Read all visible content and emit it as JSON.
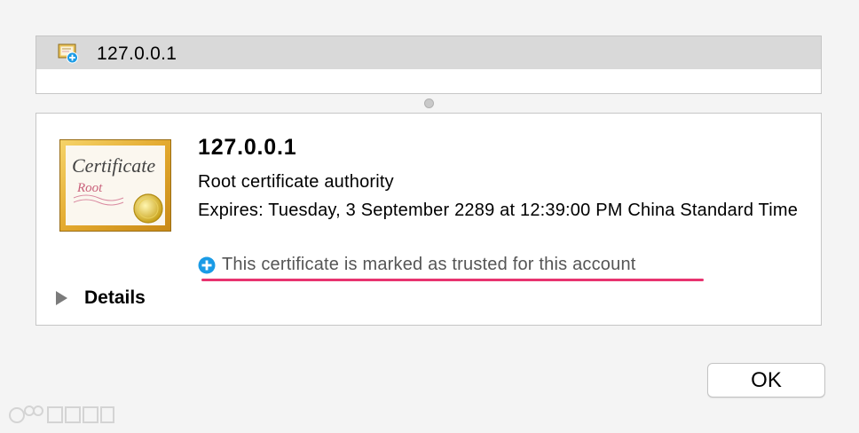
{
  "certificate_list": {
    "selected_item": "127.0.0.1"
  },
  "certificate_detail": {
    "title": "127.0.0.1",
    "type": "Root certificate authority",
    "expires": "Expires: Tuesday, 3 September 2289 at 12:39:00 PM China Standard Time",
    "trust_status": "This certificate is marked as trusted for this account",
    "details_label": "Details",
    "thumbnail_text": {
      "line1": "Certificate",
      "line2": "Root"
    }
  },
  "buttons": {
    "ok": "OK"
  },
  "colors": {
    "trust_plus": "#1a9be6",
    "highlight_underline": "#e8336f"
  }
}
